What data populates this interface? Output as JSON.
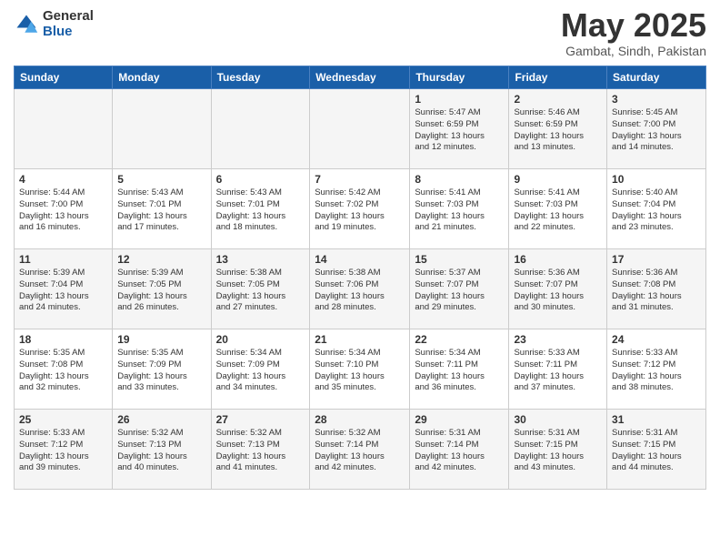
{
  "logo": {
    "general": "General",
    "blue": "Blue"
  },
  "header": {
    "month": "May 2025",
    "location": "Gambat, Sindh, Pakistan"
  },
  "weekdays": [
    "Sunday",
    "Monday",
    "Tuesday",
    "Wednesday",
    "Thursday",
    "Friday",
    "Saturday"
  ],
  "weeks": [
    [
      {
        "day": "",
        "info": ""
      },
      {
        "day": "",
        "info": ""
      },
      {
        "day": "",
        "info": ""
      },
      {
        "day": "",
        "info": ""
      },
      {
        "day": "1",
        "info": "Sunrise: 5:47 AM\nSunset: 6:59 PM\nDaylight: 13 hours\nand 12 minutes."
      },
      {
        "day": "2",
        "info": "Sunrise: 5:46 AM\nSunset: 6:59 PM\nDaylight: 13 hours\nand 13 minutes."
      },
      {
        "day": "3",
        "info": "Sunrise: 5:45 AM\nSunset: 7:00 PM\nDaylight: 13 hours\nand 14 minutes."
      }
    ],
    [
      {
        "day": "4",
        "info": "Sunrise: 5:44 AM\nSunset: 7:00 PM\nDaylight: 13 hours\nand 16 minutes."
      },
      {
        "day": "5",
        "info": "Sunrise: 5:43 AM\nSunset: 7:01 PM\nDaylight: 13 hours\nand 17 minutes."
      },
      {
        "day": "6",
        "info": "Sunrise: 5:43 AM\nSunset: 7:01 PM\nDaylight: 13 hours\nand 18 minutes."
      },
      {
        "day": "7",
        "info": "Sunrise: 5:42 AM\nSunset: 7:02 PM\nDaylight: 13 hours\nand 19 minutes."
      },
      {
        "day": "8",
        "info": "Sunrise: 5:41 AM\nSunset: 7:03 PM\nDaylight: 13 hours\nand 21 minutes."
      },
      {
        "day": "9",
        "info": "Sunrise: 5:41 AM\nSunset: 7:03 PM\nDaylight: 13 hours\nand 22 minutes."
      },
      {
        "day": "10",
        "info": "Sunrise: 5:40 AM\nSunset: 7:04 PM\nDaylight: 13 hours\nand 23 minutes."
      }
    ],
    [
      {
        "day": "11",
        "info": "Sunrise: 5:39 AM\nSunset: 7:04 PM\nDaylight: 13 hours\nand 24 minutes."
      },
      {
        "day": "12",
        "info": "Sunrise: 5:39 AM\nSunset: 7:05 PM\nDaylight: 13 hours\nand 26 minutes."
      },
      {
        "day": "13",
        "info": "Sunrise: 5:38 AM\nSunset: 7:05 PM\nDaylight: 13 hours\nand 27 minutes."
      },
      {
        "day": "14",
        "info": "Sunrise: 5:38 AM\nSunset: 7:06 PM\nDaylight: 13 hours\nand 28 minutes."
      },
      {
        "day": "15",
        "info": "Sunrise: 5:37 AM\nSunset: 7:07 PM\nDaylight: 13 hours\nand 29 minutes."
      },
      {
        "day": "16",
        "info": "Sunrise: 5:36 AM\nSunset: 7:07 PM\nDaylight: 13 hours\nand 30 minutes."
      },
      {
        "day": "17",
        "info": "Sunrise: 5:36 AM\nSunset: 7:08 PM\nDaylight: 13 hours\nand 31 minutes."
      }
    ],
    [
      {
        "day": "18",
        "info": "Sunrise: 5:35 AM\nSunset: 7:08 PM\nDaylight: 13 hours\nand 32 minutes."
      },
      {
        "day": "19",
        "info": "Sunrise: 5:35 AM\nSunset: 7:09 PM\nDaylight: 13 hours\nand 33 minutes."
      },
      {
        "day": "20",
        "info": "Sunrise: 5:34 AM\nSunset: 7:09 PM\nDaylight: 13 hours\nand 34 minutes."
      },
      {
        "day": "21",
        "info": "Sunrise: 5:34 AM\nSunset: 7:10 PM\nDaylight: 13 hours\nand 35 minutes."
      },
      {
        "day": "22",
        "info": "Sunrise: 5:34 AM\nSunset: 7:11 PM\nDaylight: 13 hours\nand 36 minutes."
      },
      {
        "day": "23",
        "info": "Sunrise: 5:33 AM\nSunset: 7:11 PM\nDaylight: 13 hours\nand 37 minutes."
      },
      {
        "day": "24",
        "info": "Sunrise: 5:33 AM\nSunset: 7:12 PM\nDaylight: 13 hours\nand 38 minutes."
      }
    ],
    [
      {
        "day": "25",
        "info": "Sunrise: 5:33 AM\nSunset: 7:12 PM\nDaylight: 13 hours\nand 39 minutes."
      },
      {
        "day": "26",
        "info": "Sunrise: 5:32 AM\nSunset: 7:13 PM\nDaylight: 13 hours\nand 40 minutes."
      },
      {
        "day": "27",
        "info": "Sunrise: 5:32 AM\nSunset: 7:13 PM\nDaylight: 13 hours\nand 41 minutes."
      },
      {
        "day": "28",
        "info": "Sunrise: 5:32 AM\nSunset: 7:14 PM\nDaylight: 13 hours\nand 42 minutes."
      },
      {
        "day": "29",
        "info": "Sunrise: 5:31 AM\nSunset: 7:14 PM\nDaylight: 13 hours\nand 42 minutes."
      },
      {
        "day": "30",
        "info": "Sunrise: 5:31 AM\nSunset: 7:15 PM\nDaylight: 13 hours\nand 43 minutes."
      },
      {
        "day": "31",
        "info": "Sunrise: 5:31 AM\nSunset: 7:15 PM\nDaylight: 13 hours\nand 44 minutes."
      }
    ]
  ]
}
